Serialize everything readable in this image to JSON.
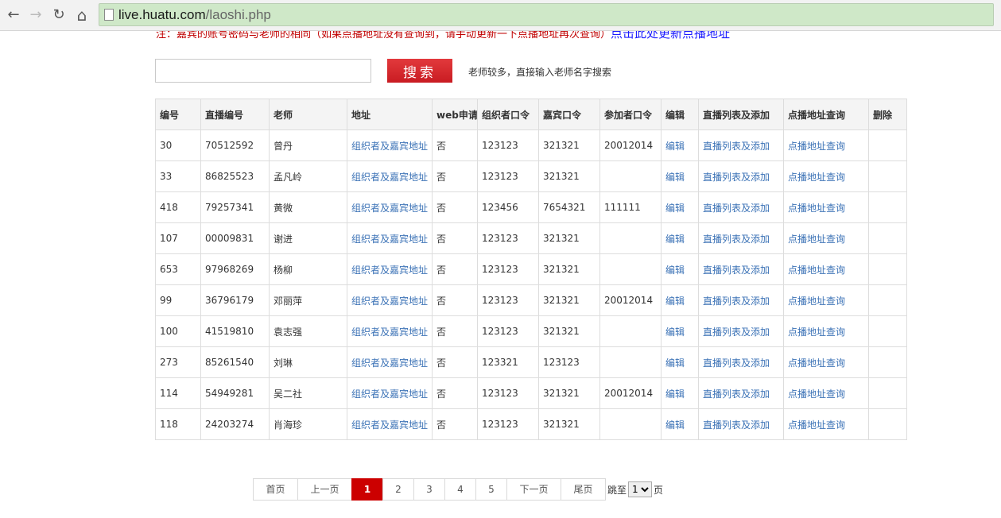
{
  "browser": {
    "back": "←",
    "forward": "→",
    "reload": "↻",
    "home": "⌂",
    "url_host": "live.huatu.com",
    "url_path": "/laoshi.php"
  },
  "notice": {
    "text": "注：嘉宾的账号密码与老师的相同（如果点播地址没有查询到，请手动更新一下点播地址再次查询）",
    "link": "点击此处更新点播地址"
  },
  "search": {
    "placeholder": "",
    "button": "搜索",
    "hint": "老师较多，直接输入老师名字搜索"
  },
  "table": {
    "headers": [
      "编号",
      "直播编号",
      "老师",
      "地址",
      "web申请",
      "组织者口令",
      "嘉宾口令",
      "参加者口令",
      "编辑",
      "直播列表及添加",
      "点播地址查询",
      "删除"
    ],
    "rows": [
      {
        "id": "30",
        "live_no": "70512592",
        "teacher": "曾丹",
        "address": "组织者及嘉宾地址",
        "web": "否",
        "org_pwd": "123123",
        "guest_pwd": "321321",
        "attend_pwd": "20012014",
        "edit": "编辑",
        "live_list": "直播列表及添加",
        "vod": "点播地址查询",
        "delete": ""
      },
      {
        "id": "33",
        "live_no": "86825523",
        "teacher": "孟凡岭",
        "address": "组织者及嘉宾地址",
        "web": "否",
        "org_pwd": "123123",
        "guest_pwd": "321321",
        "attend_pwd": "",
        "edit": "编辑",
        "live_list": "直播列表及添加",
        "vod": "点播地址查询",
        "delete": ""
      },
      {
        "id": "418",
        "live_no": "79257341",
        "teacher": "黄微",
        "address": "组织者及嘉宾地址",
        "web": "否",
        "org_pwd": "123456",
        "guest_pwd": "7654321",
        "attend_pwd": "111111",
        "edit": "编辑",
        "live_list": "直播列表及添加",
        "vod": "点播地址查询",
        "delete": ""
      },
      {
        "id": "107",
        "live_no": "00009831",
        "teacher": "谢进",
        "address": "组织者及嘉宾地址",
        "web": "否",
        "org_pwd": "123123",
        "guest_pwd": "321321",
        "attend_pwd": "",
        "edit": "编辑",
        "live_list": "直播列表及添加",
        "vod": "点播地址查询",
        "delete": ""
      },
      {
        "id": "653",
        "live_no": "97968269",
        "teacher": "杨柳",
        "address": "组织者及嘉宾地址",
        "web": "否",
        "org_pwd": "123123",
        "guest_pwd": "321321",
        "attend_pwd": "",
        "edit": "编辑",
        "live_list": "直播列表及添加",
        "vod": "点播地址查询",
        "delete": ""
      },
      {
        "id": "99",
        "live_no": "36796179",
        "teacher": "邓丽萍",
        "address": "组织者及嘉宾地址",
        "web": "否",
        "org_pwd": "123123",
        "guest_pwd": "321321",
        "attend_pwd": "20012014",
        "edit": "编辑",
        "live_list": "直播列表及添加",
        "vod": "点播地址查询",
        "delete": ""
      },
      {
        "id": "100",
        "live_no": "41519810",
        "teacher": "袁志强",
        "address": "组织者及嘉宾地址",
        "web": "否",
        "org_pwd": "123123",
        "guest_pwd": "321321",
        "attend_pwd": "",
        "edit": "编辑",
        "live_list": "直播列表及添加",
        "vod": "点播地址查询",
        "delete": ""
      },
      {
        "id": "273",
        "live_no": "85261540",
        "teacher": "刘琳",
        "address": "组织者及嘉宾地址",
        "web": "否",
        "org_pwd": "123321",
        "guest_pwd": "123123",
        "attend_pwd": "",
        "edit": "编辑",
        "live_list": "直播列表及添加",
        "vod": "点播地址查询",
        "delete": ""
      },
      {
        "id": "114",
        "live_no": "54949281",
        "teacher": "吴二社",
        "address": "组织者及嘉宾地址",
        "web": "否",
        "org_pwd": "123123",
        "guest_pwd": "321321",
        "attend_pwd": "20012014",
        "edit": "编辑",
        "live_list": "直播列表及添加",
        "vod": "点播地址查询",
        "delete": ""
      },
      {
        "id": "118",
        "live_no": "24203274",
        "teacher": "肖海珍",
        "address": "组织者及嘉宾地址",
        "web": "否",
        "org_pwd": "123123",
        "guest_pwd": "321321",
        "attend_pwd": "",
        "edit": "编辑",
        "live_list": "直播列表及添加",
        "vod": "点播地址查询",
        "delete": ""
      }
    ]
  },
  "pagination": {
    "first": "首页",
    "prev": "上一页",
    "pages": [
      "1",
      "2",
      "3",
      "4",
      "5"
    ],
    "current": "1",
    "next": "下一页",
    "last": "尾页",
    "jump_prefix": "跳至",
    "jump_value": "1",
    "jump_suffix": "页"
  },
  "colors": {
    "accent_red": "#cc0000",
    "link_blue": "#3b72b6",
    "omnibox_green": "#cfe8c8"
  }
}
